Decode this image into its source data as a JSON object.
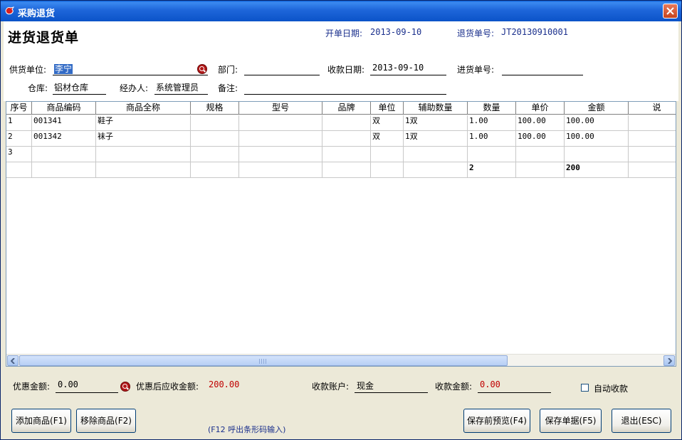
{
  "window": {
    "title": "采购退货"
  },
  "header": {
    "form_title": "进货退货单",
    "open_date_label": "开单日期:",
    "open_date": "2013-09-10",
    "return_no_label": "退货单号:",
    "return_no": "JT20130910001",
    "supplier_label": "供货单位:",
    "supplier": "李宁",
    "department_label": "部门:",
    "department": "",
    "receipt_date_label": "收款日期:",
    "receipt_date": "2013-09-10",
    "purchase_no_label": "进货单号:",
    "purchase_no": "",
    "warehouse_label": "仓库:",
    "warehouse": "铝材仓库",
    "handler_label": "经办人:",
    "handler": "系统管理员",
    "remark_label": "备注:",
    "remark": ""
  },
  "grid": {
    "columns": [
      "序号",
      "商品编码",
      "商品全称",
      "规格",
      "型号",
      "品牌",
      "单位",
      "辅助数量",
      "数量",
      "单价",
      "金额",
      "说"
    ],
    "rows": [
      [
        "1",
        "001341",
        "鞋子",
        "",
        "",
        "",
        "双",
        "1双",
        "1.00",
        "100.00",
        "100.00",
        ""
      ],
      [
        "2",
        "001342",
        "袜子",
        "",
        "",
        "",
        "双",
        "1双",
        "1.00",
        "100.00",
        "100.00",
        ""
      ],
      [
        "3",
        "",
        "",
        "",
        "",
        "",
        "",
        "",
        "",
        "",
        "",
        ""
      ]
    ],
    "totals": [
      "",
      "",
      "",
      "",
      "",
      "",
      "",
      "",
      "2",
      "",
      "200",
      ""
    ]
  },
  "footer": {
    "discount_label": "优惠金额:",
    "discount": "0.00",
    "after_discount_label": "优惠后应收金额:",
    "after_discount": "200.00",
    "account_label": "收款账户:",
    "account": "现金",
    "receipt_amount_label": "收款金额:",
    "receipt_amount": "0.00",
    "auto_receipt_label": "自动收款",
    "auto_receipt_checked": false,
    "add_button": "添加商品(F1)",
    "remove_button": "移除商品(F2)",
    "barcode_hint": "(F12 呼出条形码输入)",
    "preview_button": "保存前预览(F4)",
    "save_button": "保存单据(F5)",
    "exit_button": "退出(ESC)"
  },
  "colors": {
    "title_bar": "#0B53C8",
    "label_blue": "#1A2F8C",
    "amount_red": "#C00000",
    "selection": "#316AC5"
  }
}
